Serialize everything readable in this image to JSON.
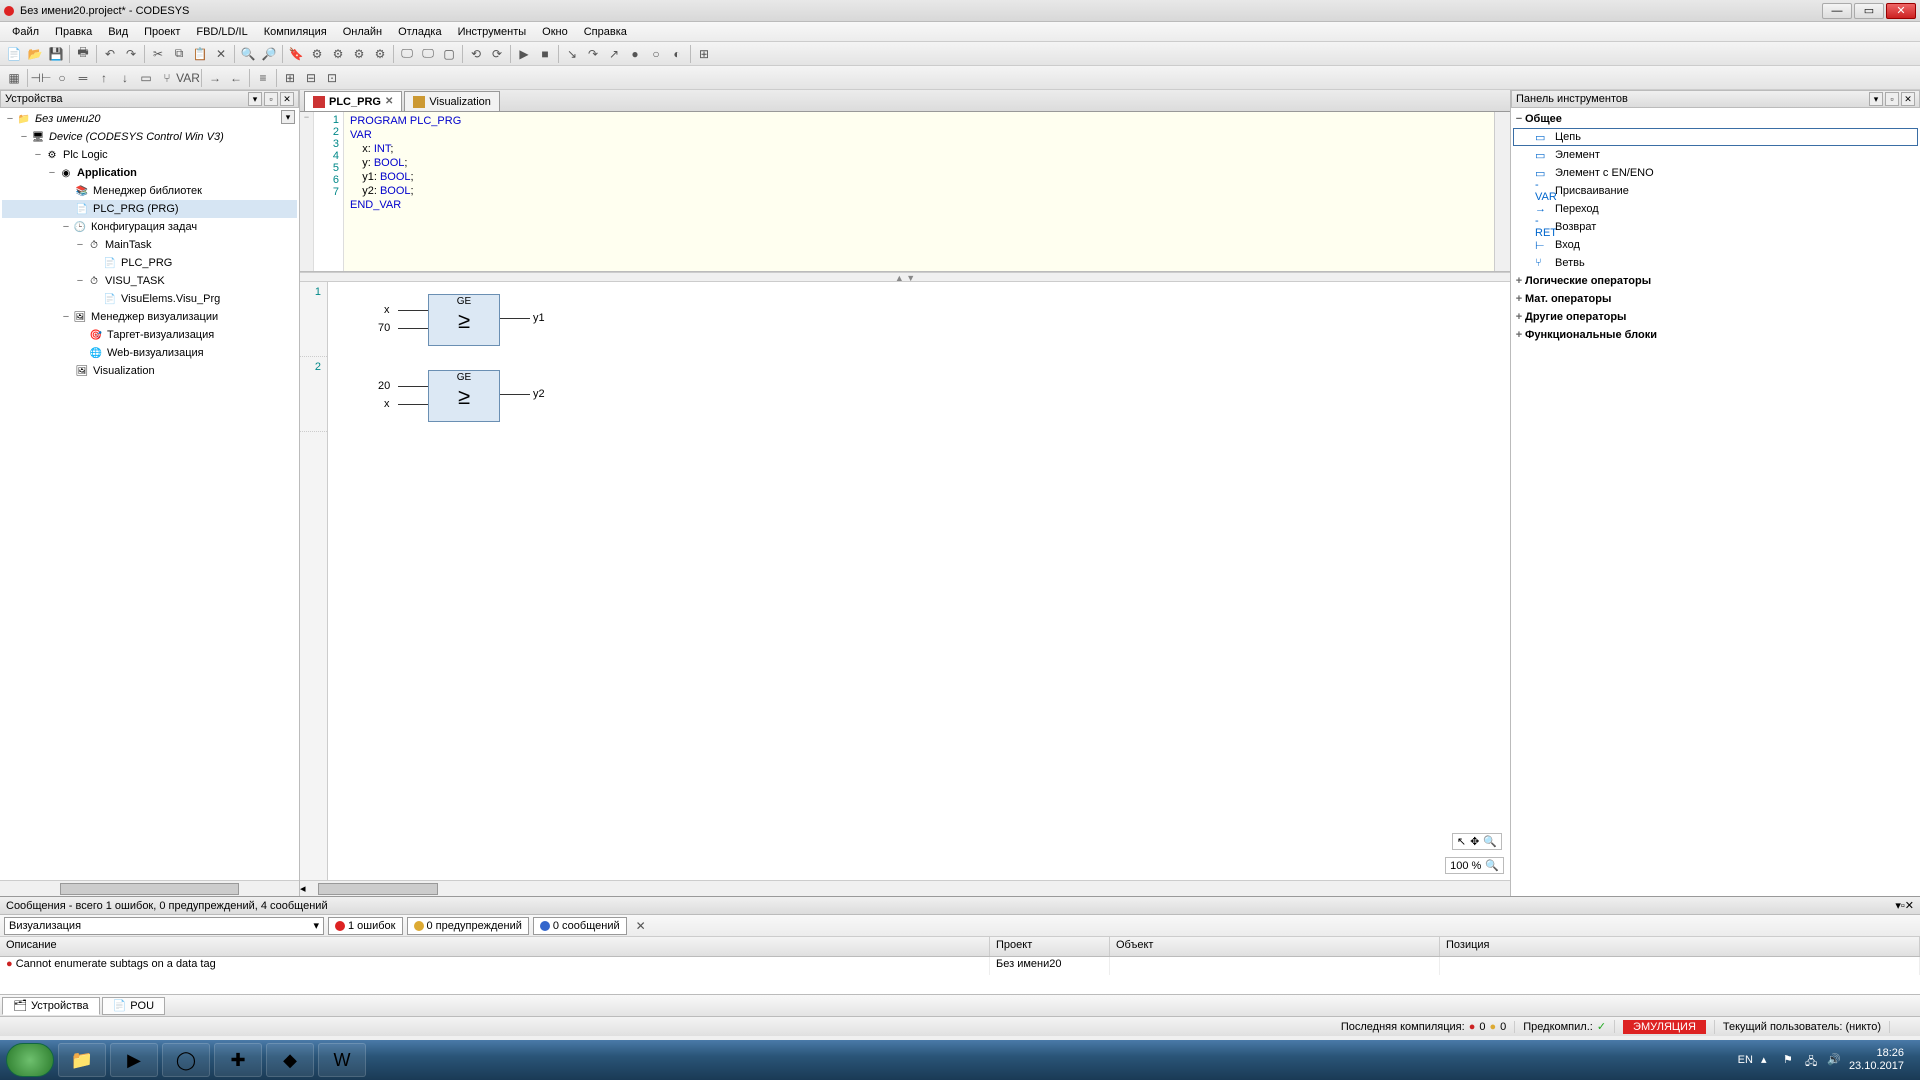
{
  "titlebar": {
    "title": "Без имени20.project* - CODESYS"
  },
  "menu": [
    "Файл",
    "Правка",
    "Вид",
    "Проект",
    "FBD/LD/IL",
    "Компиляция",
    "Онлайн",
    "Отладка",
    "Инструменты",
    "Окно",
    "Справка"
  ],
  "panels": {
    "devices_title": "Устройства",
    "toolbox_title": "Панель инструментов"
  },
  "tree": {
    "root": "Без имени20",
    "device": "Device (CODESYS Control Win V3)",
    "plc_logic": "Plc Logic",
    "application": "Application",
    "lib_manager": "Менеджер библиотек",
    "plc_prg": "PLC_PRG (PRG)",
    "task_cfg": "Конфигурация задач",
    "main_task": "MainTask",
    "plc_prg_ref": "PLC_PRG",
    "visu_task": "VISU_TASK",
    "visu_elems": "VisuElems.Visu_Prg",
    "visu_mgr": "Менеджер визуализации",
    "target_visu": "Таргет-визуализация",
    "web_visu": "Web-визуализация",
    "visualization": "Visualization"
  },
  "editor_tabs": {
    "tab1": "PLC_PRG",
    "tab2": "Visualization"
  },
  "code": {
    "l1": "PROGRAM PLC_PRG",
    "l2": "VAR",
    "l3_a": "    x: ",
    "l3_b": "INT",
    "l3_c": ";",
    "l4_a": "    y: ",
    "l4_b": "BOOL",
    "l4_c": ";",
    "l5_a": "    y1: ",
    "l5_b": "BOOL",
    "l5_c": ";",
    "l6_a": "    y2: ",
    "l6_b": "BOOL",
    "l6_c": ";",
    "l7": "END_VAR",
    "ln": [
      "1",
      "2",
      "3",
      "4",
      "5",
      "6",
      "7"
    ]
  },
  "fbd": {
    "r1": "1",
    "r2": "2",
    "block1_name": "GE",
    "block1_sym": "≥",
    "block1_in1": "x",
    "block1_in2": "70",
    "block1_out": "y1",
    "block2_name": "GE",
    "block2_sym": "≥",
    "block2_in1": "20",
    "block2_in2": "x",
    "block2_out": "y2",
    "zoom": "100 %"
  },
  "toolbox": {
    "cat_general": "Общее",
    "items_general": [
      "Цепь",
      "Элемент",
      "Элемент с EN/ENO",
      "Присваивание",
      "Переход",
      "Возврат",
      "Вход",
      "Ветвь"
    ],
    "cat_logic": "Логические операторы",
    "cat_math": "Мат. операторы",
    "cat_other": "Другие операторы",
    "cat_fb": "Функциональные блоки"
  },
  "messages": {
    "header": "Сообщения - всего 1 ошибок, 0 предупреждений, 4 сообщений",
    "combo": "Визуализация",
    "f_err": "1 ошибок",
    "f_warn": "0 предупреждений",
    "f_info": "0 сообщений",
    "cols": {
      "desc": "Описание",
      "proj": "Проект",
      "obj": "Объект",
      "pos": "Позиция"
    },
    "row": {
      "desc": "Cannot enumerate subtags on a data tag",
      "proj": "Без имени20"
    }
  },
  "bottom_tabs": {
    "t1": "Устройства",
    "t2": "POU"
  },
  "status": {
    "last_compile": "Последняя компиляция:",
    "precompile": "Предкомпил.:",
    "emu": "ЭМУЛЯЦИЯ",
    "user": "Текущий пользователь: (никто)",
    "e0": "0",
    "w0": "0"
  },
  "tray": {
    "lang": "EN",
    "time": "18:26",
    "date": "23.10.2017"
  }
}
